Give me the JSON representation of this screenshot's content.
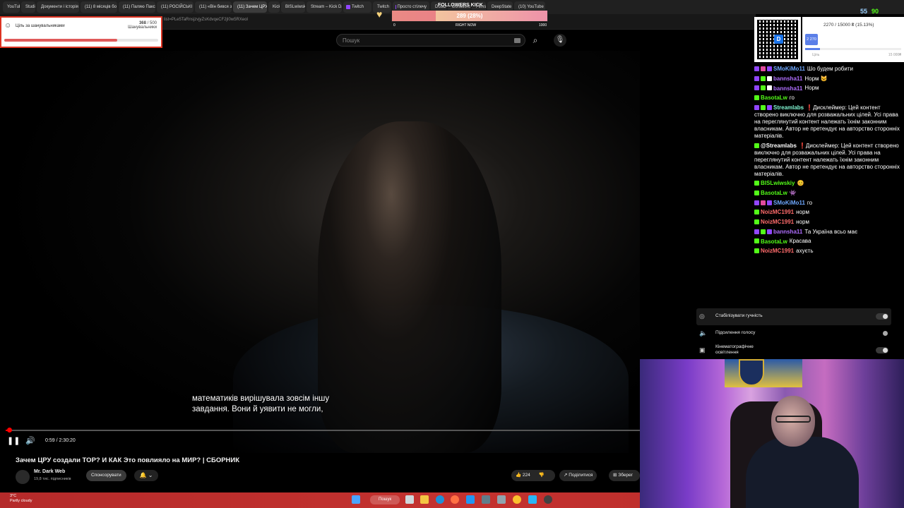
{
  "browser": {
    "tabs": [
      {
        "label": "YouTube",
        "color": "#e53935"
      },
      {
        "label": "Studio",
        "color": "#e53935"
      },
      {
        "label": "Документи і історія",
        "color": "#43a047"
      },
      {
        "label": "(11) 8 місяців бо",
        "color": "#e53935"
      },
      {
        "label": "(11) Паляю Пакс",
        "color": "#e53935"
      },
      {
        "label": "(11) РОСІЙСЬКІ",
        "color": "#e53935"
      },
      {
        "label": "(11) «Він бився з",
        "color": "#e53935"
      },
      {
        "label": "(11) Зачем ЦРУ",
        "color": "#e53935",
        "active": true
      },
      {
        "label": "Kick",
        "color": "#53fc18"
      },
      {
        "label": "BISLwiwskiy",
        "color": "#53fc18"
      },
      {
        "label": "Stream – Kick Da",
        "color": "#53fc18"
      },
      {
        "label": "Twitch",
        "color": "#9146ff"
      },
      {
        "label": "Twitch",
        "color": "#9146ff"
      },
      {
        "label": "Просто стілечу",
        "color": "#9146ff"
      },
      {
        "label": "Dota2",
        "color": "#c23c2a"
      },
      {
        "label": "Donations",
        "color": "#3b6fd8"
      },
      {
        "label": "Films",
        "color": "#e53935"
      },
      {
        "label": "DeepState",
        "color": "#1e88e5"
      },
      {
        "label": "(10) YouTube",
        "color": "#e53935"
      }
    ],
    "url": "list=PLe5TaRnsjzvjyZsKdvqeCF2jI0w5RXeol"
  },
  "youtube": {
    "search_placeholder": "Пошук",
    "subtitle_line1": "математиків вирішувала зовсім іншу",
    "subtitle_line2": "завдання. Вони й уявити не могли,",
    "time": "0:59 / 2:30:20",
    "progress_fraction": 0.007,
    "title": "Зачем ЦРУ создали TOP? И КАК Это повлияло на МИР? | СБОРНИК",
    "channel_name": "Mr. Dark Web",
    "channel_subs": "19,8 тис. підписників",
    "sponsor_label": "Спонсорувати",
    "likes": "224",
    "share_label": "Поділитися",
    "save_label": "Зберег"
  },
  "settings_popup": {
    "items": [
      {
        "label": "Стабілізувати гучність",
        "icon": "volume-stabilize-icon",
        "on": true
      },
      {
        "label": "Підсилення голосу",
        "icon": "voice-boost-icon",
        "on": true
      },
      {
        "label": "Кінематографічне освітлення",
        "icon": "cinema-lighting-icon",
        "on": true
      }
    ]
  },
  "goal_widget": {
    "title": "Ціль за шанувальниками",
    "current": "368",
    "total": "500",
    "sub": "Шанувальники",
    "fraction": 0.736
  },
  "followers_kick": {
    "label": "FOLLOWERS KICK",
    "value_text": "289 (28%)",
    "fraction": 0.28,
    "min": "0",
    "mid": "RIGHT NOW",
    "max": "1000"
  },
  "donation_widget": {
    "amount_text": "2270 / 15000 ₴ (15.13%)",
    "badge": "2 270",
    "min": "Ціль",
    "max": "15 000₴",
    "fraction": 0.1513
  },
  "stats": {
    "viewers_a": "55",
    "viewers_b": "90"
  },
  "chat": [
    {
      "user": "SMoKiMo11",
      "color": "#6fa8ff",
      "badges": [
        "#9146ff",
        "#e24b9e",
        "#9146ff"
      ],
      "text": "Шо будем робити"
    },
    {
      "user": "bannsha11",
      "color": "#b06fff",
      "badges": [
        "#9146ff",
        "#53fc18",
        "#ffffff"
      ],
      "text": "Норм 😺"
    },
    {
      "user": "bannsha11",
      "color": "#b06fff",
      "badges": [
        "#9146ff",
        "#53fc18",
        "#ffffff"
      ],
      "text": "Норм"
    },
    {
      "user": "BasotaLw",
      "color": "#53fc18",
      "badges": [
        "#53fc18"
      ],
      "text": "го"
    },
    {
      "user": "Streamlabs",
      "color": "#80f5d2",
      "badges": [
        "#9146ff",
        "#53fc18",
        "#9146ff"
      ],
      "text": "❗Дисклеймер: Цей контент створено виключно для розважальних цілей. Усі права на переглянутий контент належать їхнім законним власникам. Автор не претендує на авторство сторонніх матеріалів."
    },
    {
      "user": "@Streamlabs",
      "color": "#ffffff",
      "badges": [
        "#53fc18"
      ],
      "text": "❗Дисклеймер: Цей контент створено виключно для розважальних цілей. Усі права на переглянутий контент належать їхнім законним власникам. Автор не претендує на авторство сторонніх матеріалів."
    },
    {
      "user": "BISLwiwskiy",
      "color": "#53fc18",
      "badges": [
        "#53fc18"
      ],
      "text": "😊"
    },
    {
      "user": "BasotaLw",
      "color": "#53fc18",
      "badges": [
        "#53fc18"
      ],
      "text": "👾"
    },
    {
      "user": "SMoKiMo11",
      "color": "#6fa8ff",
      "badges": [
        "#9146ff",
        "#e24b9e",
        "#9146ff"
      ],
      "text": "го"
    },
    {
      "user": "NoizMC1991",
      "color": "#ff6b6b",
      "badges": [
        "#53fc18"
      ],
      "text": "норм"
    },
    {
      "user": "NoizMC1991",
      "color": "#ff6b6b",
      "badges": [
        "#53fc18"
      ],
      "text": "норм"
    },
    {
      "user": "bannsha11",
      "color": "#b06fff",
      "badges": [
        "#9146ff",
        "#53fc18",
        "#9146ff"
      ],
      "text": "Та Україна всьо має"
    },
    {
      "user": "BasotaLw",
      "color": "#53fc18",
      "badges": [
        "#53fc18"
      ],
      "text": "Красава"
    },
    {
      "user": "NoizMC1991",
      "color": "#ff6b6b",
      "badges": [
        "#53fc18"
      ],
      "text": "ахуєть"
    }
  ],
  "taskbar": {
    "weather_temp": "3°C",
    "weather_text": "Partly cloudy",
    "search_label": "Пошук"
  }
}
